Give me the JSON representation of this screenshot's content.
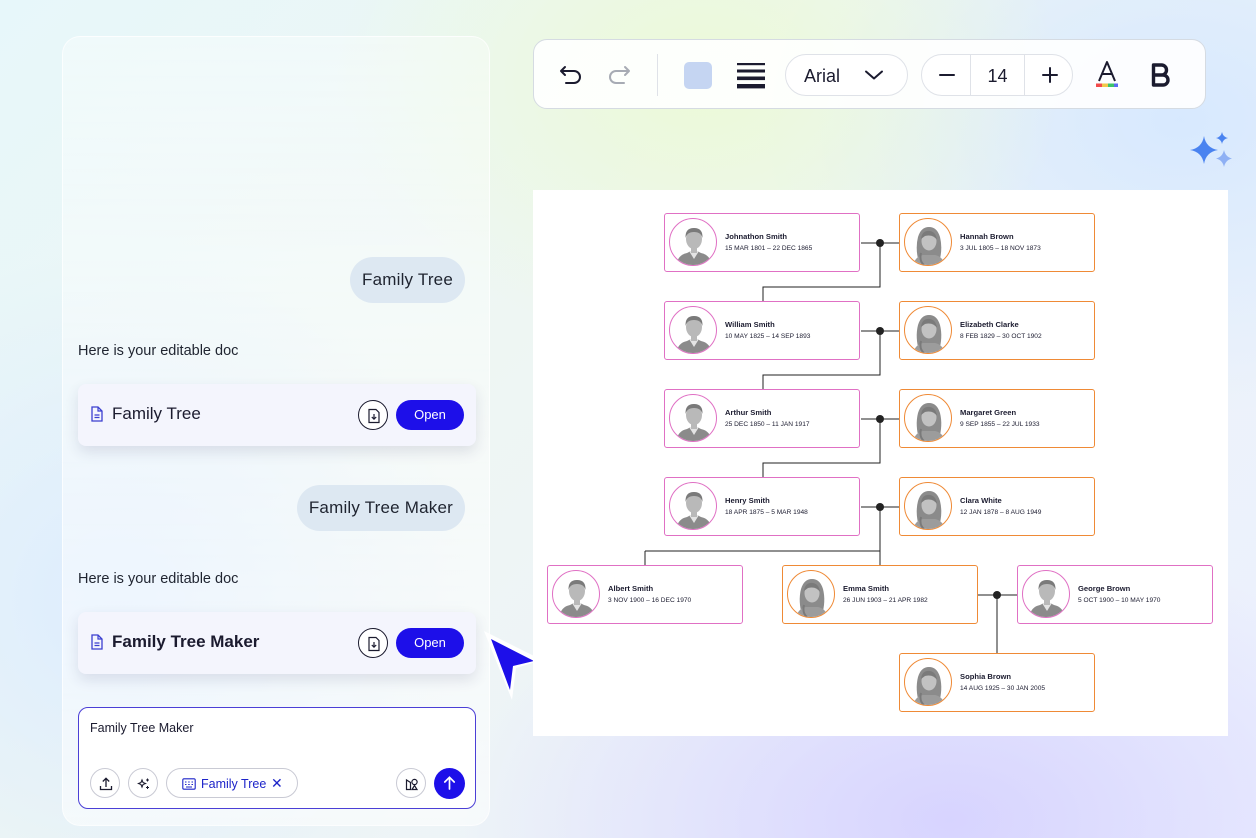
{
  "chat": {
    "messages": [
      {
        "role": "user",
        "text": "Family Tree"
      },
      {
        "role": "assistant",
        "text": "Here is your editable doc"
      },
      {
        "role": "user",
        "text": "Family Tree Maker"
      },
      {
        "role": "assistant",
        "text": "Here is your editable doc"
      }
    ],
    "doc_cards": [
      {
        "title": "Family Tree",
        "open_label": "Open",
        "icon": "document-icon",
        "download_icon": "download-icon"
      },
      {
        "title": "Family Tree Maker",
        "open_label": "Open",
        "icon": "document-icon",
        "download_icon": "download-icon"
      }
    ],
    "input": {
      "value": "Family Tree Maker",
      "chip_label": "Family Tree",
      "chip_icon": "keyboard-icon",
      "tools": [
        "upload-icon",
        "magic-wand-icon",
        "shapes-icon"
      ],
      "send_icon": "arrow-up-icon"
    }
  },
  "toolbar": {
    "icons": [
      "undo-icon",
      "redo-icon",
      "fill-color-swatch",
      "line-style-icon",
      "font-color-icon",
      "bold-icon"
    ],
    "font": "Arial",
    "font_size": "14",
    "swatch_color": "#c5d5f2"
  },
  "colors": {
    "accent": "#1d0fe9",
    "male_border": "#e070c4",
    "female_border": "#ef8a36"
  },
  "family_tree": {
    "people": [
      {
        "name": "Johnathon Smith",
        "dates": "15 MAR 1801 – 22 DEC 1865",
        "gender": "male"
      },
      {
        "name": "Hannah Brown",
        "dates": "3 JUL 1805 – 18 NOV 1873",
        "gender": "female"
      },
      {
        "name": "William Smith",
        "dates": "10 MAY 1825 – 14 SEP 1893",
        "gender": "male"
      },
      {
        "name": "Elizabeth Clarke",
        "dates": "8 FEB 1829 – 30 OCT 1902",
        "gender": "female"
      },
      {
        "name": "Arthur Smith",
        "dates": "25 DEC 1850 – 11 JAN 1917",
        "gender": "male"
      },
      {
        "name": "Margaret Green",
        "dates": "9 SEP 1855 – 22 JUL 1933",
        "gender": "female"
      },
      {
        "name": "Henry Smith",
        "dates": "18 APR 1875 – 5 MAR 1948",
        "gender": "male"
      },
      {
        "name": "Clara White",
        "dates": "12 JAN 1878 – 8 AUG 1949",
        "gender": "female"
      },
      {
        "name": "Albert Smith",
        "dates": "3 NOV 1900 – 16 DEC 1970",
        "gender": "male"
      },
      {
        "name": "Emma Smith",
        "dates": "26 JUN 1903 – 21 APR 1982",
        "gender": "female"
      },
      {
        "name": "George Brown",
        "dates": "5 OCT 1900 – 10 MAY 1970",
        "gender": "male"
      },
      {
        "name": "Sophia Brown",
        "dates": "14 AUG 1925 – 30 JAN 2005",
        "gender": "female"
      }
    ]
  }
}
